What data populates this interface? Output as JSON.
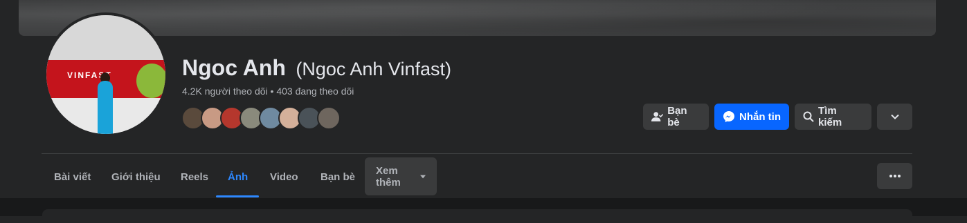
{
  "profile": {
    "name": "Ngoc Anh",
    "alternate_name": "(Ngoc Anh Vinfast)",
    "stats": "4.2K người theo dõi • 403 đang theo dõi",
    "avatar_brand_text": "VINFAST"
  },
  "friend_avatar_colors": [
    "#5a4a3c",
    "#c89a84",
    "#b5372d",
    "#8a8a7c",
    "#6f8aa0",
    "#d4b09a",
    "#4a5258",
    "#6e665e"
  ],
  "actions": {
    "friends_label": "Bạn bè",
    "message_label": "Nhắn tin",
    "search_label": "Tìm kiếm"
  },
  "tabs": [
    {
      "label": "Bài viết"
    },
    {
      "label": "Giới thiệu"
    },
    {
      "label": "Reels"
    },
    {
      "label": "Ảnh"
    },
    {
      "label": "Video"
    },
    {
      "label": "Bạn bè"
    },
    {
      "label": "Xem thêm"
    }
  ],
  "colors": {
    "accent": "#0866ff",
    "active_tab": "#2d88ff",
    "background": "#242526"
  }
}
